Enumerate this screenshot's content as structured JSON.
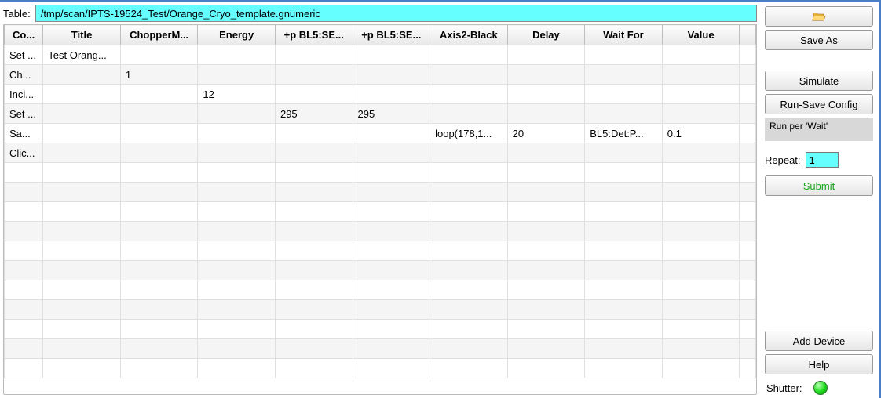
{
  "header": {
    "table_label": "Table:",
    "path": "/tmp/scan/IPTS-19524_Test/Orange_Cryo_template.gnumeric"
  },
  "columns": [
    {
      "label": "Co...",
      "width": 48
    },
    {
      "label": "Title",
      "width": 96
    },
    {
      "label": "ChopperM...",
      "width": 96
    },
    {
      "label": "Energy",
      "width": 96
    },
    {
      "label": "+p BL5:SE...",
      "width": 96
    },
    {
      "label": "+p BL5:SE...",
      "width": 96
    },
    {
      "label": "Axis2-Black",
      "width": 96
    },
    {
      "label": "Delay",
      "width": 96
    },
    {
      "label": "Wait For",
      "width": 96
    },
    {
      "label": "Value",
      "width": 96
    },
    {
      "label": "",
      "width": 20
    }
  ],
  "rows": [
    [
      "Set ...",
      "Test Orang...",
      "",
      "",
      "",
      "",
      "",
      "",
      "",
      "",
      ""
    ],
    [
      "Ch...",
      "",
      "1",
      "",
      "",
      "",
      "",
      "",
      "",
      "",
      ""
    ],
    [
      "Inci...",
      "",
      "",
      "12",
      "",
      "",
      "",
      "",
      "",
      "",
      ""
    ],
    [
      "Set ...",
      "",
      "",
      "",
      "295",
      "295",
      "",
      "",
      "",
      "",
      ""
    ],
    [
      "Sa...",
      "",
      "",
      "",
      "",
      "",
      "loop(178,1...",
      "20",
      "BL5:Det:P...",
      "0.1",
      ""
    ],
    [
      "Clic...",
      "",
      "",
      "",
      "",
      "",
      "",
      "",
      "",
      "",
      ""
    ],
    [
      "",
      "",
      "",
      "",
      "",
      "",
      "",
      "",
      "",
      "",
      ""
    ],
    [
      "",
      "",
      "",
      "",
      "",
      "",
      "",
      "",
      "",
      "",
      ""
    ],
    [
      "",
      "",
      "",
      "",
      "",
      "",
      "",
      "",
      "",
      "",
      ""
    ],
    [
      "",
      "",
      "",
      "",
      "",
      "",
      "",
      "",
      "",
      "",
      ""
    ],
    [
      "",
      "",
      "",
      "",
      "",
      "",
      "",
      "",
      "",
      "",
      ""
    ],
    [
      "",
      "",
      "",
      "",
      "",
      "",
      "",
      "",
      "",
      "",
      ""
    ],
    [
      "",
      "",
      "",
      "",
      "",
      "",
      "",
      "",
      "",
      "",
      ""
    ],
    [
      "",
      "",
      "",
      "",
      "",
      "",
      "",
      "",
      "",
      "",
      ""
    ],
    [
      "",
      "",
      "",
      "",
      "",
      "",
      "",
      "",
      "",
      "",
      ""
    ],
    [
      "",
      "",
      "",
      "",
      "",
      "",
      "",
      "",
      "",
      "",
      ""
    ],
    [
      "",
      "",
      "",
      "",
      "",
      "",
      "",
      "",
      "",
      "",
      ""
    ]
  ],
  "sidebar": {
    "open_icon": "folder-open-icon",
    "save_as": "Save As",
    "simulate": "Simulate",
    "run_save_config": "Run-Save Config",
    "run_per_wait": "Run per 'Wait'",
    "repeat_label": "Repeat:",
    "repeat_value": "1",
    "submit": "Submit",
    "add_device": "Add Device",
    "help": "Help",
    "shutter_label": "Shutter:"
  }
}
